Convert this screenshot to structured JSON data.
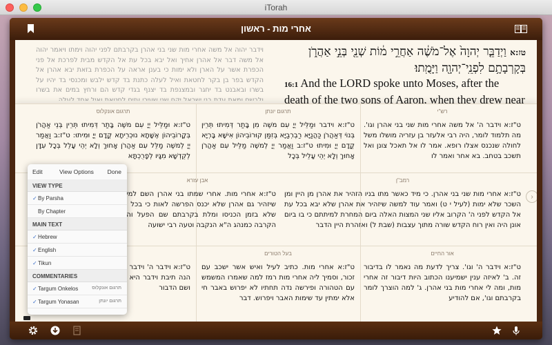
{
  "window": {
    "title": "iTorah"
  },
  "header": {
    "title": "אחרי מות - ראשון"
  },
  "main": {
    "hebrew_verse_num": "טז:א",
    "hebrew_verse": "וַיְדַבֵּ֤ר יְהוָה֙ אֶל־מֹשֶׁ֔ה אַחֲרֵ֣י מ֔וֹת שְׁנֵ֖י בְּנֵ֣י אַהֲרֹ֑ן בְּקָרְבָתָ֥ם לִפְנֵֽי־יְהוָ֖ה וַיָּמֻֽתוּ׃",
    "english_verse_num": "16:1",
    "english_verse": "And the LORD spoke unto Moses, after the death of the two sons of Aaron, when they drew near before the LORD, and died;",
    "tikun_text": "וידבר יהוה אל משה אחרי מות שני בני אהרן בקרבתם לפני יהוה וימתו ויאמר יהוה אל משה דבר אל אהרן אחיך ואל יבא בכל עת אל הקדש מבית לפרכת אל פני הכפרת אשר על הארן ולא ימות כי בענן אראה על הכפרת בזאת יבא אהרן אל הקדש בפר בן בקר לחטאת ואיל לעלה כתנת בד קדש ילבש ומכנסי בד יהיו על בשרו ובאבנט בד יחגר ובמצנפת בד יצנף בגדי קדש הם ורחץ במים את בשרו ולבשם ומאת עדת בני ישראל יקח שני שעירי עזים לחטאת ואיל אחד לעלה"
  },
  "commentaries": [
    {
      "title": "רש\"י",
      "text": "ט\"ז:א וידבר ה' אל משה אחרי מות שני בני אהרן וגו'. מה תלמוד לומר, היה רבי אלעזר בן עזריה מושלו משל לחולה שנכנס אצלו רופא. אמר לו אל תאכל צונן ואל תשכב בטחב. בא אחר ואמר לו"
    },
    {
      "title": "תרגום יונתן",
      "text": "ט\"ז:א וידבר וּמַלֵּיל יְיָ עִם משֶׁה מִן בָּתַר דְּמִיתוּ תְּרֵין בְּנוֹי דְּאַהֲרֹן כַּהֲנַיָּא רַבְרְבַיָּא בְּזִמַּן קוּרוֹבֵיהוֹן אִישָּׁא בָּרְיָא קֳדָם יְיָ וּמִיתוּ ט\"ז:ב וַאֲמַר יְיָ לְמשֶׁה מַלֵּיל עִם אַהֲרֹן אָחוּךְ וְלָא יְהֵי עָלֵיל בְּכָל"
    },
    {
      "title": "תרגום אונקלוס",
      "text": "ט\"ז:א וּמַלֵּיל יְיָ עִם משֶׁה בָּתַר דְּמִיתוּ תְּרֵין בְּנֵי אַהֲרֹן בְּקָרוֹבֵיהוֹן אֶשָּׁתָא נוּכְרֵיתָא קֳדָם יְיָ וּמִיתוּ: ט\"ז:ב וַאֲמַר יְיָ לְמשֶׁה מַלֵּל עִם אַהֲרֹן אָחוּךְ וְלָא יְהֵי עָלֵל בְּכָל עִדָּן לְקֻדְשָׁא מִגָּיו לְפָרֻכְתָּא"
    },
    {
      "title": "רמב\"ן",
      "text": "ט\"ז:א אחרי מות שני בני אהרן. כי מיד כאשר מתו בניו הזהיר את אהרן מן היין ומן השכר שלא ימות (לעיל י ט) ואמר עוד למשה שיזהיר את אהרן שלא יבא בכל עת אל הקדש לפני ה' הקרוב אליו שני המצות האלה ביום המחרת למיתתם כי בו ביום אונן היה ואין רוח הקדש שורה מתוך עצבות (שבת ל) ואזהרת היין הדבר"
    },
    {
      "title": "אבן עזרא",
      "text": "ט\"ז:א אחרי מות. אחרי שמתו בני אהרן השם למשה שיזהיר גם אהרן שלא יכנס הפרשה לאות כי בכל עת שלא בזמן הכניסו ומלת בקרבתם שם הפעל וה\"א הקרבה כמנהג ה\"א הנקבה וטעה רבי ישועה"
    },
    {
      "title": "אור החיים",
      "text": "ט\"ז:א וידבר ה' וגו'. צריך לדעת מה נאמר לו בדיבור זה. ב' לאיזה ענין ישמיענו הכתוב היות דיבור זה אחרי מות, ומה לי אחרי מות בני אהרן. ג' למה הוצרך לומר בקרבתם וגו', אם להודיע"
    },
    {
      "title": "בעל הטורים",
      "text": "ט\"ז:א אחרי מות. כתיב לעיל ואיש אשר ישכב עם זכור, וסמיך ליה אחרי מות רמז למה שאמרו המשמש עם הטהורה ופירשה נדה תחתיו לא יפרוש באבר חי אלא ימתין עד שימות האבר ויפרוש. דבר"
    },
    {
      "title": "",
      "text": "ט\"ז:א וידבר ה' וידבר ה' אל משה. וידבר ה' על חלקי הנה תיבת וידבר היא הדבור הלשון כללו ובראו ברוב ושם הדבור"
    }
  ],
  "view_options": {
    "edit_label": "Edit",
    "title": "View Options",
    "done_label": "Done",
    "sections": [
      {
        "title": "VIEW TYPE",
        "items": [
          {
            "label": "By Parsha",
            "checked": true,
            "hebrew": ""
          },
          {
            "label": "By Chapter",
            "checked": false,
            "hebrew": ""
          }
        ]
      },
      {
        "title": "MAIN TEXT",
        "items": [
          {
            "label": "Hebrew",
            "checked": true,
            "hebrew": ""
          },
          {
            "label": "English",
            "checked": true,
            "hebrew": ""
          },
          {
            "label": "Tikun",
            "checked": true,
            "hebrew": ""
          }
        ]
      },
      {
        "title": "COMMENTARIES",
        "items": [
          {
            "label": "Targum Onkelos",
            "checked": true,
            "hebrew": "תרגום אונקלוס"
          },
          {
            "label": "Targum Yonasan",
            "checked": true,
            "hebrew": "תרגום יונתן"
          }
        ]
      }
    ]
  },
  "icons": {
    "bookmark": "bookmark-icon",
    "book": "book-open-icon",
    "settings": "gear-icon",
    "download": "download-icon",
    "note": "note-icon",
    "star": "star-icon",
    "mic": "microphone-icon",
    "next": "chevron-right-icon"
  },
  "colors": {
    "frame": "#4a2610",
    "page": "#fbf6ec",
    "accent": "#3a6ec8"
  }
}
